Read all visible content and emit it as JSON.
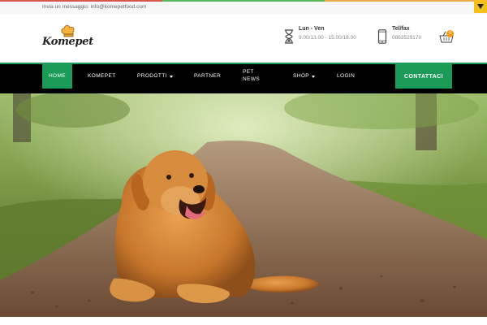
{
  "colors": {
    "accent_green": "#1a9b57",
    "badge_orange": "#f39c12",
    "toggle_yellow": "#f4c01c",
    "nav_background": "#000000",
    "top_stripe": [
      "#d9534f",
      "#5cb85c",
      "#f0ad4e"
    ]
  },
  "top_bar": {
    "message": "Invia un messaggio: info@komepetfood.com",
    "toggle_icon": "chevron-down-icon"
  },
  "header": {
    "logo_text": "Komepet",
    "logo_icon": "chef-hat-icon",
    "hours": {
      "icon": "hourglass-icon",
      "title": "Lun - Ven",
      "value": "9.00/13.00 - 15.00/18.00"
    },
    "phone": {
      "icon": "mobile-phone-icon",
      "title": "Tel/fax",
      "value": "0863529170"
    },
    "cart": {
      "icon": "basket-icon",
      "count": "0"
    }
  },
  "nav": {
    "items": [
      {
        "label": "Home"
      },
      {
        "label": "Komepet"
      },
      {
        "label": "Prodotti"
      },
      {
        "label": "Partner"
      },
      {
        "label": "Pet news"
      },
      {
        "label": "Shop"
      },
      {
        "label": "Login"
      }
    ],
    "cta_label": "Contattaci"
  },
  "hero": {
    "subject": "golden retriever lying on a forest path"
  }
}
